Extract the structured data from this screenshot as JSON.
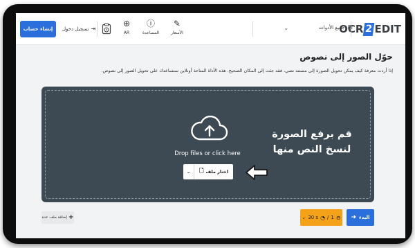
{
  "header": {
    "logo_prefix": "OCR",
    "logo_number": "2",
    "logo_suffix": "EDIT",
    "tools_menu_label": "جميع الأدوات",
    "nav": [
      {
        "label": "الأسعار",
        "icon": "tag-icon"
      },
      {
        "label": "المساعدة",
        "icon": "help-icon"
      },
      {
        "label": "AR",
        "icon": "globe-icon"
      }
    ],
    "history_icon": "clipboard-clock-icon",
    "login_label": "تسجيل دخول",
    "signup_label": "إنشاء حساب"
  },
  "main": {
    "title": "حوّل الصور إلى نصوص",
    "description": "إذا أردت معرفة كيف يمكن تحويل الصورة إلى مستند نصي، فقد جئت إلى المكان الصحيح. هذه الأداة المتاحة أونلاين ستساعدك على تحويل الصور إلى نصوص."
  },
  "dropzone": {
    "drop_text": "Drop files or click here",
    "choose_file_label": "اختار ملف",
    "annotation_line1": "قم برفع الصورة",
    "annotation_line2": "لنسخ النص منها"
  },
  "footer": {
    "start_label": "البدء",
    "quota_count": "1",
    "quota_time": "30 s",
    "add_files_label": "إضافة ملف عدة"
  },
  "colors": {
    "accent": "#2a6fdb",
    "dropzone_bg": "#3d4a53",
    "quota_bg": "#f5a21b"
  }
}
